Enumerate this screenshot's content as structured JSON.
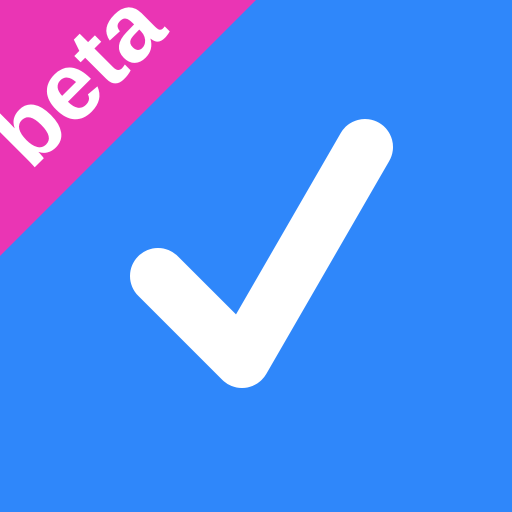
{
  "icon": {
    "name": "checkmark-icon",
    "background_color": "#2F87FA",
    "check_color": "#FFFFFF"
  },
  "ribbon": {
    "label": "beta",
    "background_color": "#EA35B4",
    "text_color": "#FFFFFF"
  }
}
